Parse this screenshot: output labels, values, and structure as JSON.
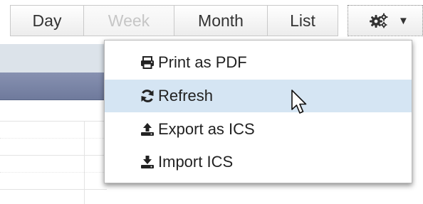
{
  "toolbar": {
    "views": [
      {
        "label": "Day",
        "state": "normal"
      },
      {
        "label": "Week",
        "state": "disabled"
      },
      {
        "label": "Month",
        "state": "normal"
      },
      {
        "label": "List",
        "state": "normal"
      }
    ],
    "options_button": {
      "icon": "gears-icon",
      "caret": "▼"
    }
  },
  "menu": {
    "items": [
      {
        "label": "Print as PDF",
        "icon": "print-icon"
      },
      {
        "label": "Refresh",
        "icon": "refresh-icon",
        "highlighted": true
      },
      {
        "label": "Export as ICS",
        "icon": "upload-icon"
      },
      {
        "label": "Import ICS",
        "icon": "download-icon"
      }
    ]
  },
  "colors": {
    "hover_bg": "#d5e5f3",
    "header_band": "#7a84a5",
    "disabled_text": "#c6c6c6"
  }
}
